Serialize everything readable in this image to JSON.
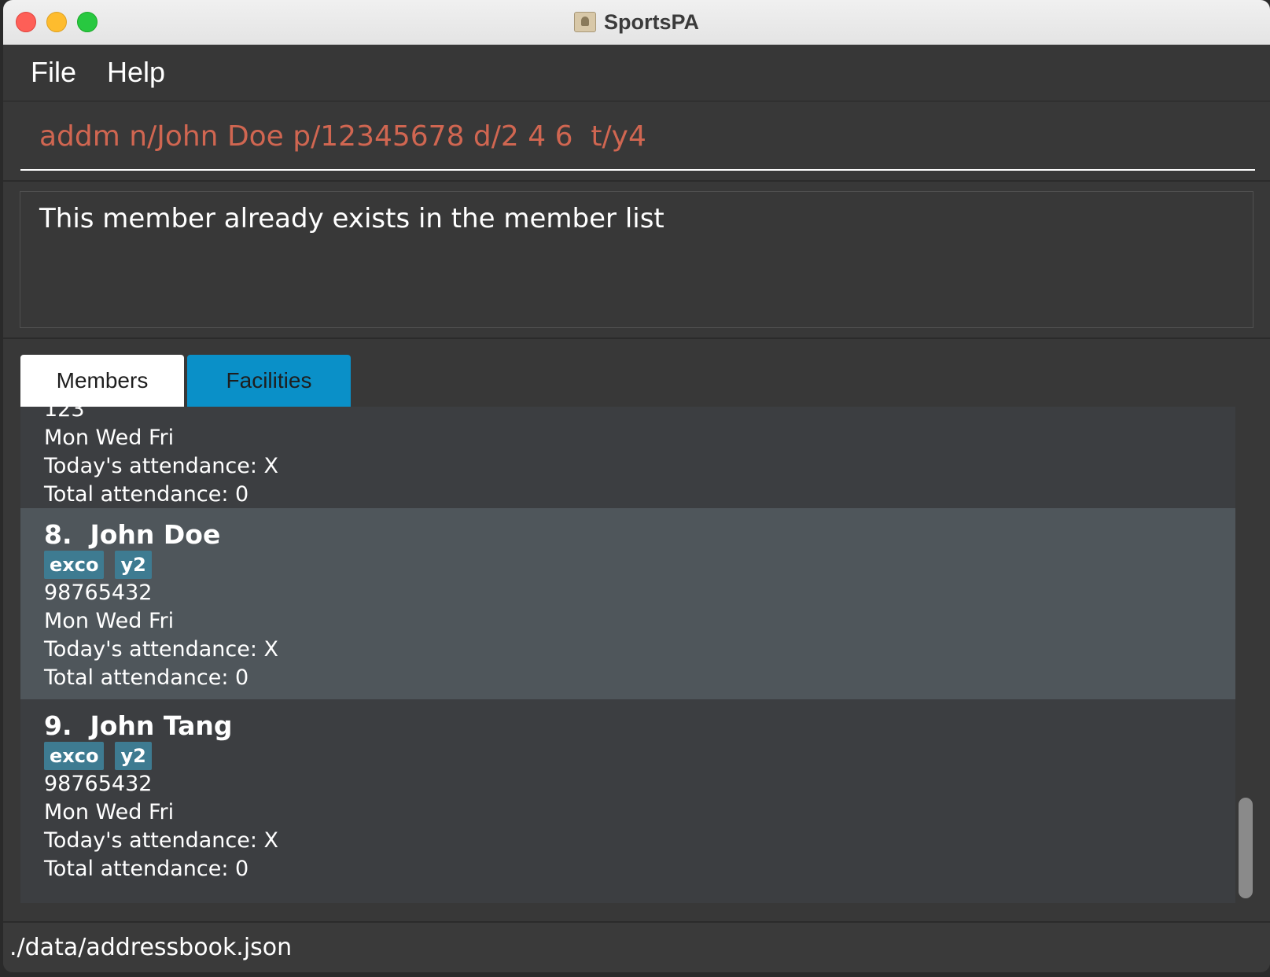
{
  "window": {
    "title": "SportsPA"
  },
  "menu": {
    "file": "File",
    "help": "Help"
  },
  "command": {
    "value": "addm n/John Doe p/12345678 d/2 4 6  t/y4"
  },
  "result": {
    "message": "This member already exists in the member list"
  },
  "tabs": {
    "members": "Members",
    "facilities": "Facilities",
    "active": "Members"
  },
  "members_partial": {
    "phone": "123",
    "days": "Mon Wed Fri",
    "today": "Today's attendance: X",
    "total": "Total attendance: 0"
  },
  "members": [
    {
      "index": "8.",
      "name": "John Doe",
      "tags": [
        "exco",
        "y2"
      ],
      "phone": "98765432",
      "days": "Mon Wed Fri",
      "today": "Today's attendance: X",
      "total": "Total attendance: 0",
      "selected": true
    },
    {
      "index": "9.",
      "name": "John Tang",
      "tags": [
        "exco",
        "y2"
      ],
      "phone": "98765432",
      "days": "Mon Wed Fri",
      "today": "Today's attendance: X",
      "total": "Total attendance: 0",
      "selected": false
    }
  ],
  "status": {
    "path": "./data/addressbook.json"
  },
  "colors": {
    "command_text": "#d06651",
    "tab_active_bg": "#ffffff",
    "tab_inactive_bg": "#0a90c8",
    "tag_bg": "#3e7b91",
    "selected_card_bg": "#4f565b"
  }
}
